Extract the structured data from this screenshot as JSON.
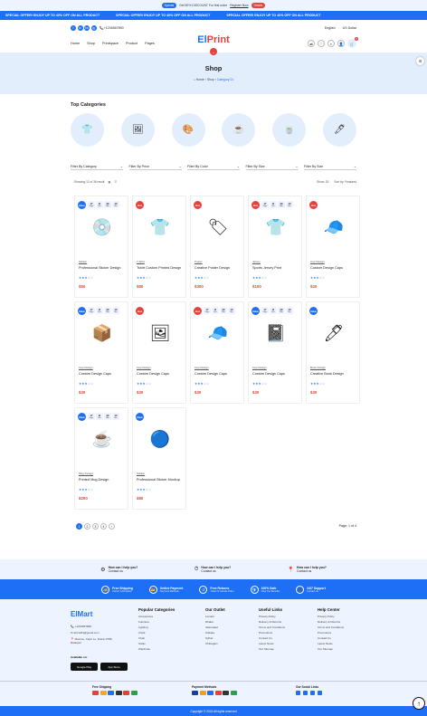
{
  "topbar": {
    "tag": "Special",
    "text": "Get 50% DISCOUNT For first order",
    "link": "Register Now",
    "cta": "Details"
  },
  "ticker": {
    "items": [
      "SPECIAL OFFER! ENJOY UP TO 40% OFF ON ALL PRODUCT",
      "SPECIAL OFFER! ENJOY UP TO 40% OFF ON ALL PRODUCT",
      "SPECIAL OFFER! ENJOY UP TO 40% OFF ON ALL PRODUCT"
    ]
  },
  "header": {
    "phone": "+1234567890",
    "language": "English",
    "currency": "US Dollar",
    "social": [
      "f",
      "in",
      "tw",
      "ig"
    ],
    "nav": [
      "Home",
      "Shop",
      "Printspace",
      "Product",
      "Pages"
    ],
    "logo_a": "El",
    "logo_b": "Print",
    "cart_count": "0"
  },
  "hero": {
    "title": "Shop",
    "crumb_home": "Home",
    "crumb_shop": "Shop",
    "crumb_cat": "Category 01"
  },
  "categories": {
    "title": "Top Categories",
    "icons": [
      "👕",
      "🖼",
      "🎨",
      "☕",
      "🍵",
      "🖊"
    ]
  },
  "filters": [
    "Filter By Category",
    "Filter By Price",
    "Filter By Color",
    "Filter By Size",
    "Filter By Size"
  ],
  "toolbar": {
    "result": "Showing 12 of 36 result",
    "show": "Show: 30",
    "sort": "Sort by: Featured"
  },
  "products": [
    {
      "badge": "New",
      "badge_color": "#1e6ff5",
      "countdown": [
        "17",
        "11",
        "29",
        "10"
      ],
      "icon": "💿",
      "cat": "Sticker",
      "name": "Professional Sticker Design",
      "price": "$50"
    },
    {
      "badge": "Hot",
      "badge_color": "#e8413b",
      "countdown": [],
      "icon": "👕",
      "cat": "T-Shirt",
      "name": "Tshirt Custom Printed Design",
      "price": "$80"
    },
    {
      "badge": "Hot",
      "badge_color": "#e8413b",
      "countdown": [],
      "icon": "🏷",
      "cat": "Poster",
      "name": "Creative Poster Design",
      "price": "$300"
    },
    {
      "badge": "Hot",
      "badge_color": "#e8413b",
      "countdown": [
        "17",
        "11",
        "29",
        "10"
      ],
      "icon": "👕",
      "cat": "Jersey",
      "name": "Sports Jersey Print",
      "price": "$100"
    },
    {
      "badge": "Hot",
      "badge_color": "#e8413b",
      "countdown": [],
      "icon": "🧢",
      "cat": "Cap Design",
      "name": "Custom Design Caps",
      "price": "$20"
    },
    {
      "badge": "New",
      "badge_color": "#1e6ff5",
      "countdown": [
        "17",
        "11",
        "29",
        "10"
      ],
      "icon": "📦",
      "cat": "Cap Design",
      "name": "Custom Design Caps",
      "price": "$30"
    },
    {
      "badge": "Hot",
      "badge_color": "#e8413b",
      "countdown": [],
      "icon": "🖼",
      "cat": "Cap Design",
      "name": "Custom Design Caps",
      "price": "$30"
    },
    {
      "badge": "Hot",
      "badge_color": "#e8413b",
      "countdown": [
        "17",
        "11",
        "29",
        "10"
      ],
      "icon": "🧢",
      "cat": "Cap Design",
      "name": "Custom Design Caps",
      "price": "$30"
    },
    {
      "badge": "New",
      "badge_color": "#1e6ff5",
      "countdown": [
        "17",
        "11",
        "29",
        "10"
      ],
      "icon": "📓",
      "cat": "Cap Design",
      "name": "Custom Design Caps",
      "price": "$30"
    },
    {
      "badge": "New",
      "badge_color": "#1e6ff5",
      "countdown": [],
      "icon": "🖊",
      "cat": "Book Design",
      "name": "Creative Book Design",
      "price": "$30"
    },
    {
      "badge": "New",
      "badge_color": "#1e6ff5",
      "countdown": [
        "17",
        "11",
        "29",
        "10"
      ],
      "icon": "☕",
      "cat": "Mug Design",
      "name": "Printed Mug Design",
      "price": "$200"
    },
    {
      "badge": "New",
      "badge_color": "#1e6ff5",
      "countdown": [],
      "icon": "🔵",
      "cat": "Sticker",
      "name": "Professional Sticker Mockup",
      "price": "$80"
    }
  ],
  "countdown_labels": [
    "Days",
    "Hrs",
    "Min",
    "Sec"
  ],
  "pagination": {
    "pages": [
      "1",
      "2",
      "3",
      "4"
    ],
    "next": "›",
    "page_of": "Page: 1 of 4"
  },
  "help": [
    {
      "title": "How can I help you?",
      "sub": "Contact us"
    },
    {
      "title": "How can I help you?",
      "sub": "Contact us"
    },
    {
      "title": "How can I help you?",
      "sub": "Contact us"
    }
  ],
  "features": [
    {
      "title": "Free Shipping",
      "sub": "Carrier Information"
    },
    {
      "title": "Online Payment",
      "sub": "Payment Methods"
    },
    {
      "title": "Free Returns",
      "sub": "Track Or Cancle Order"
    },
    {
      "title": "100% Safe",
      "sub": "View Our Benefits"
    },
    {
      "title": "24/7 Support",
      "sub": "Contact us"
    }
  ],
  "footer": {
    "logo": "ElMart",
    "phone": "+1234567890",
    "email": "abc1234@gmail.com",
    "address": "Maxime, Capri Lo, Dulcis 0785, Rataquin",
    "available": "Available on:",
    "gplay": "Google Play",
    "appstore": "App Store",
    "cols": [
      {
        "title": "Popular Categories",
        "items": [
          "Accessories",
          "Furniture",
          "Lighting",
          "Clock",
          "Chair",
          "Sofas",
          "Wardrobe"
        ]
      },
      {
        "title": "Our Outlet",
        "items": [
          "London",
          "Dhaka",
          "Islamabad",
          "Kolkata",
          "Sylhet",
          "Chittagain"
        ]
      },
      {
        "title": "Useful Links",
        "items": [
          "Privacy Policy",
          "Delivery & Returns",
          "Terms and Conditions",
          "Promotions",
          "Contact Us",
          "Latest News",
          "Our Sitemap"
        ]
      },
      {
        "title": "Help Center",
        "items": [
          "Privacy Policy",
          "Delivery & Returns",
          "Terms and Conditions",
          "Promotions",
          "Contact Us",
          "Latest News",
          "Our Sitemap"
        ]
      }
    ],
    "free_shipping": "Free Shipping",
    "payment": "Payment Methods",
    "social": "Our Social Links",
    "copyright": "Copyright © 2024 All rights reserved"
  },
  "colors": {
    "primary": "#1e6ff5",
    "accent": "#e8413b"
  }
}
